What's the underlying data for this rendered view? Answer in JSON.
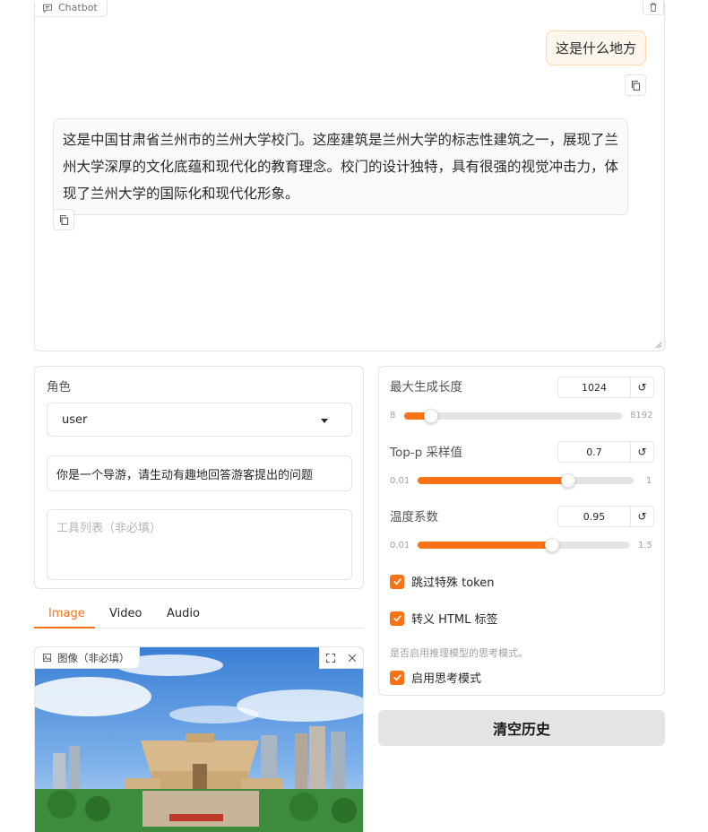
{
  "chatbot": {
    "label": "Chatbot",
    "messages": [
      {
        "role": "user",
        "text": "这是什么地方"
      },
      {
        "role": "assistant",
        "text": "这是中国甘肃省兰州市的兰州大学校门。这座建筑是兰州大学的标志性建筑之一，展现了兰州大学深厚的文化底蕴和现代化的教育理念。校门的设计独特，具有很强的视觉冲击力，体现了兰州大学的国际化和现代化形象。"
      }
    ]
  },
  "left_panel": {
    "role_label": "角色",
    "role_value": "user",
    "system_value": "你是一个导游，请生动有趣地回答游客提出的问题",
    "tools_placeholder": "工具列表（非必填）"
  },
  "tabs": [
    {
      "label": "Image",
      "active": true
    },
    {
      "label": "Video",
      "active": false
    },
    {
      "label": "Audio",
      "active": false
    }
  ],
  "image_input": {
    "label": "图像（非必填）"
  },
  "params": {
    "max_length": {
      "label": "最大生成长度",
      "value": "1024",
      "min": "8",
      "max": "8192",
      "fraction": 0.124
    },
    "top_p": {
      "label": "Top-p 采样值",
      "value": "0.7",
      "min": "0.01",
      "max": "1",
      "fraction": 0.697
    },
    "temperature": {
      "label": "温度系数",
      "value": "0.95",
      "min": "0.01",
      "max": "1.5",
      "fraction": 0.631
    },
    "reset_glyph": "↺"
  },
  "checkboxes": {
    "skip_special": {
      "label": "跳过特殊 token",
      "checked": true
    },
    "escape_html": {
      "label": "转义 HTML 标签",
      "checked": true
    },
    "think_info": "是否启用推理模型的思考模式。",
    "enable_thinking": {
      "label": "启用思考模式",
      "checked": true
    }
  },
  "clear_button": "清空历史",
  "colors": {
    "accent": "#f97316",
    "user_bubble": "#fff7ed",
    "bot_bubble": "#f9fafb",
    "border": "#e4e4e7",
    "button_bg": "#e4e4e7"
  }
}
